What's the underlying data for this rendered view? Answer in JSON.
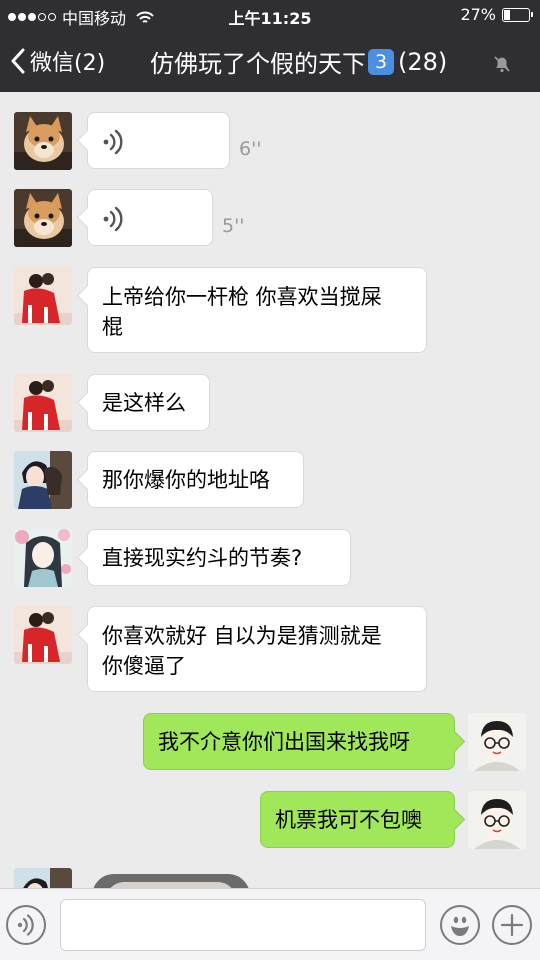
{
  "status": {
    "carrier": "中国移动",
    "time": "上午11:25",
    "battery": "27%",
    "battery_level": 0.27
  },
  "nav": {
    "back_label": "微信(2)",
    "title": "仿佛玩了个假的天下",
    "badge": "3",
    "member_count": "(28)"
  },
  "messages": [
    {
      "side": "in",
      "type": "voice",
      "duration": "6''"
    },
    {
      "side": "in",
      "type": "voice",
      "duration": "5''"
    },
    {
      "side": "in",
      "type": "text",
      "line1": "上帝给你一杆枪 你喜欢当搅屎",
      "line2": "棍"
    },
    {
      "side": "in",
      "type": "text",
      "line1": "是这样么"
    },
    {
      "side": "in",
      "type": "text",
      "line1": "那你爆你的地址咯"
    },
    {
      "side": "in",
      "type": "text",
      "line1": "直接现实约斗的节奏?"
    },
    {
      "side": "in",
      "type": "text",
      "line1": "你喜欢就好 自以为是猜测就是",
      "line2": "你傻逼了"
    },
    {
      "side": "out",
      "type": "text",
      "line1": "我不介意你们出国来找我呀"
    },
    {
      "side": "out",
      "type": "text",
      "line1": "机票我可不包噢"
    }
  ],
  "input": {
    "placeholder": ""
  },
  "icons": {
    "back": "chevron-left-icon",
    "mute": "bell-off-icon",
    "voice": "voice-icon",
    "emoji": "emoji-icon",
    "plus": "plus-icon"
  },
  "colors": {
    "nav_bg": "#2e2e33",
    "chat_bg": "#ebebeb",
    "outgoing_bubble": "#a0e75a",
    "incoming_bubble": "#ffffff",
    "badge": "#4a8fe2"
  }
}
